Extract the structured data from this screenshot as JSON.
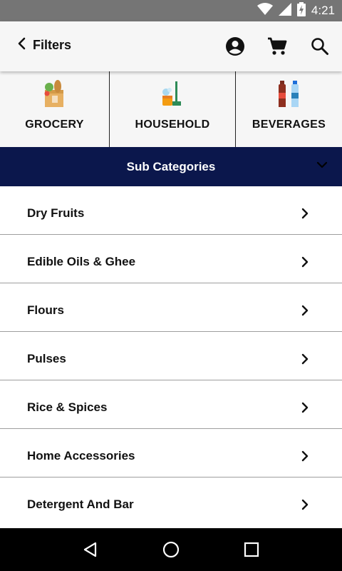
{
  "status": {
    "time": "4:21",
    "battery_icon": "battery-charging-icon",
    "wifi_icon": "wifi-icon",
    "signal_icon": "signal-icon"
  },
  "header": {
    "back_label": "Filters",
    "icons": [
      "account-circle-icon",
      "cart-icon",
      "search-icon"
    ]
  },
  "categories": [
    {
      "label": "GROCERY",
      "icon": "grocery-bag-icon"
    },
    {
      "label": "HOUSEHOLD",
      "icon": "household-cleaning-icon"
    },
    {
      "label": "BEVERAGES",
      "icon": "beverages-bottles-icon"
    }
  ],
  "subcategories": {
    "title": "Sub Categories",
    "items": [
      "Dry Fruits",
      "Edible Oils & Ghee",
      "Flours",
      "Pulses",
      "Rice & Spices",
      "Home Accessories",
      "Detergent And Bar"
    ]
  },
  "colors": {
    "header_bg": "#0b174c",
    "status_bg": "#757575",
    "appbar_bg": "#f6f6f6"
  }
}
